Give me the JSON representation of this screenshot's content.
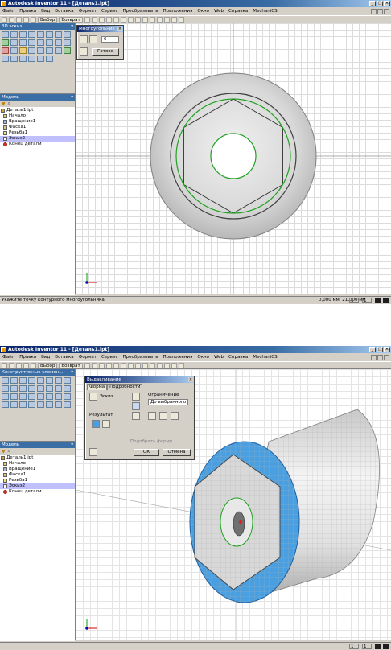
{
  "app": {
    "title1": "Autodesk Inventor 11 - [Деталь1.ipt]",
    "title2": "Autodesk Inventor 11 - [Деталь1.ipt]"
  },
  "menu": [
    "Файл",
    "Правка",
    "Вид",
    "Вставка",
    "Формат",
    "Сервис",
    "Преобразовать",
    "Приложения",
    "Окно",
    "Web",
    "Справка",
    "MechaniCS"
  ],
  "toolbar": {
    "select": "Выбор",
    "return": "Возврат"
  },
  "screen1": {
    "panel_title": "3D эскиз",
    "dialog": {
      "title": "Многоугольник",
      "sides_value": "6",
      "done_label": "Готово"
    },
    "status_text": "Укажите точку контурного многоугольника",
    "coords": "0,000 мм, 21,000 мм",
    "cell1": "1",
    "cell2": "1"
  },
  "screen2": {
    "panel_title": "Конструктивные элемен...",
    "dialog": {
      "title": "Выдавливание",
      "tab_form": "Форма",
      "tab_details": "Подробности",
      "sketch_label": "Эскиз",
      "result_label": "Результат",
      "extents_label": "Ограничение",
      "extents_value": "До выбранного",
      "match_shape": "Подобрать форму",
      "ok_label": "ОК",
      "cancel_label": "Отмена"
    },
    "cell1": "1",
    "cell2": "1"
  },
  "browser": {
    "title": "Модель",
    "items": [
      "Деталь1.ipt",
      "Начало",
      "Вращение1",
      "Фаска1",
      "Резьба1",
      "Эскиз2",
      "Конец детали"
    ]
  },
  "colors": {
    "title_bar": "#0a246a",
    "selection": "#4a9fe0",
    "sketch": "#20a020"
  }
}
